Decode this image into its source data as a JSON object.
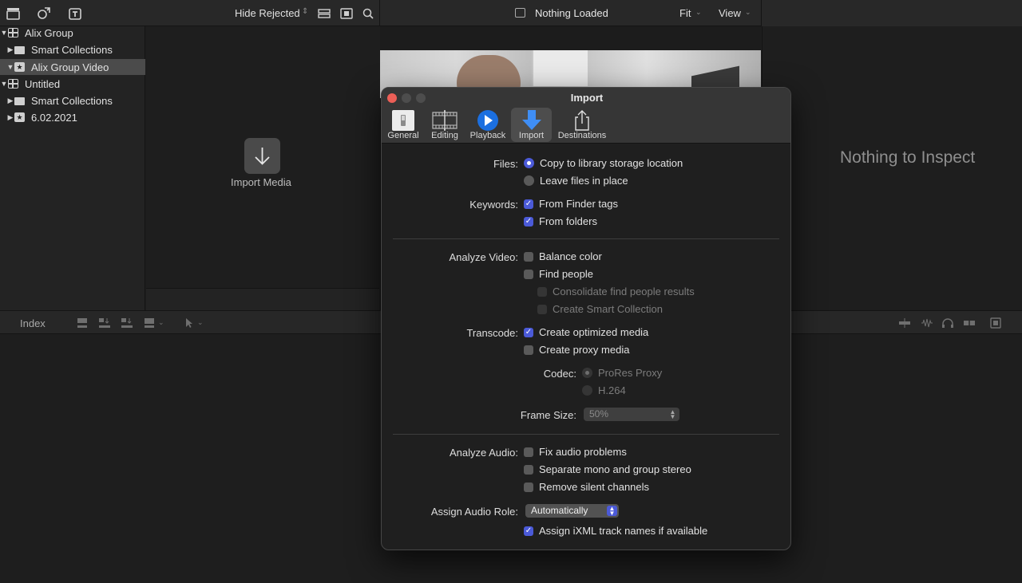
{
  "toolbar": {
    "hide_rejected": "Hide Rejected",
    "viewer_title": "Nothing Loaded",
    "fit": "Fit",
    "view": "View"
  },
  "sidebar": {
    "items": [
      {
        "label": "Alix Group",
        "icon": "library-icon",
        "expanded": true,
        "selected": false
      },
      {
        "label": "Smart Collections",
        "icon": "folder-icon",
        "expanded": false,
        "selected": false
      },
      {
        "label": "Alix Group Video",
        "icon": "event-icon",
        "expanded": true,
        "selected": true
      },
      {
        "label": "Untitled",
        "icon": "library-icon",
        "expanded": true,
        "selected": false
      },
      {
        "label": "Smart Collections",
        "icon": "folder-icon",
        "expanded": false,
        "selected": false
      },
      {
        "label": "6.02.2021",
        "icon": "event-icon",
        "expanded": false,
        "selected": false
      }
    ]
  },
  "browser": {
    "import_label": "Import Media"
  },
  "inspector": {
    "empty_text": "Nothing to Inspect"
  },
  "timeline": {
    "index_label": "Index"
  },
  "dialog": {
    "title": "Import",
    "tabs": [
      {
        "label": "General",
        "icon": "general-switch-icon",
        "active": false
      },
      {
        "label": "Editing",
        "icon": "editing-filmstrip-icon",
        "active": false
      },
      {
        "label": "Playback",
        "icon": "play-icon",
        "active": false
      },
      {
        "label": "Import",
        "icon": "download-arrow-icon",
        "active": true
      },
      {
        "label": "Destinations",
        "icon": "share-icon",
        "active": false
      }
    ],
    "files_label": "Files:",
    "files_options": [
      {
        "label": "Copy to library storage location",
        "checked": true
      },
      {
        "label": "Leave files in place",
        "checked": false
      }
    ],
    "keywords_label": "Keywords:",
    "keywords_options": [
      {
        "label": "From Finder tags",
        "checked": true
      },
      {
        "label": "From folders",
        "checked": true
      }
    ],
    "analyze_video_label": "Analyze Video:",
    "analyze_video_options": [
      {
        "label": "Balance color",
        "checked": false,
        "enabled": true
      },
      {
        "label": "Find people",
        "checked": false,
        "enabled": true
      },
      {
        "label": "Consolidate find people results",
        "checked": false,
        "enabled": false
      },
      {
        "label": "Create Smart Collection",
        "checked": false,
        "enabled": false
      }
    ],
    "transcode_label": "Transcode:",
    "transcode_options": [
      {
        "label": "Create optimized media",
        "checked": true
      },
      {
        "label": "Create proxy media",
        "checked": false
      }
    ],
    "codec_label": "Codec:",
    "codec_options": [
      {
        "label": "ProRes Proxy",
        "checked": true
      },
      {
        "label": "H.264",
        "checked": false
      }
    ],
    "frame_size_label": "Frame Size:",
    "frame_size_value": "50%",
    "analyze_audio_label": "Analyze Audio:",
    "analyze_audio_options": [
      {
        "label": "Fix audio problems",
        "checked": false
      },
      {
        "label": "Separate mono and group stereo",
        "checked": false
      },
      {
        "label": "Remove silent channels",
        "checked": false
      }
    ],
    "audio_role_label": "Assign Audio Role:",
    "audio_role_value": "Automatically",
    "ixml_option": {
      "label": "Assign iXML track names if available",
      "checked": true
    }
  },
  "colors": {
    "accent": "#4b5ad8",
    "close": "#ec5f57",
    "window_bg": "#1f1f1f",
    "app_bg": "#1e1e1e"
  }
}
